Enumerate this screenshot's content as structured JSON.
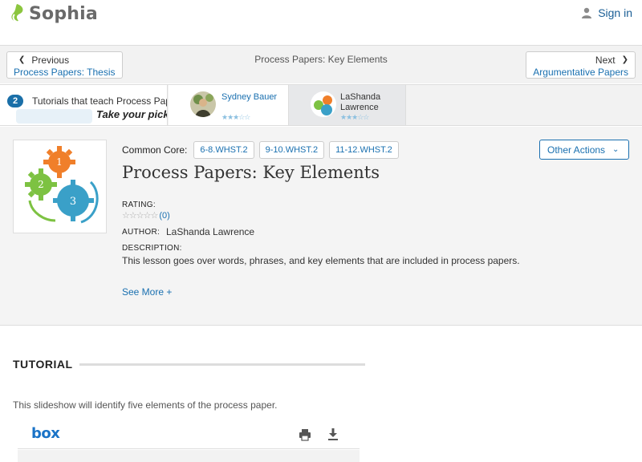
{
  "header": {
    "logo_text": "Sophia",
    "signin_label": "Sign in"
  },
  "nav": {
    "prev_label": "Previous",
    "prev_sub": "Process Papers: Thesis",
    "title": "Process Papers: Key Elements",
    "next_label": "Next",
    "next_sub": "Argumentative Papers"
  },
  "tutorials": {
    "count": "2",
    "text": "Tutorials that teach Process Papers: Key Elements",
    "pick": "Take your pick:",
    "items": [
      {
        "name": "Sydney Bauer",
        "rating_stars": "★★★☆☆",
        "rating": 3
      },
      {
        "name_line1": "LaShanda",
        "name_line2": "Lawrence",
        "rating_stars": "★★★☆☆",
        "rating": 3
      }
    ]
  },
  "detail": {
    "common_core_label": "Common Core:",
    "tags": [
      "6-8.WHST.2",
      "9-10.WHST.2",
      "11-12.WHST.2"
    ],
    "other_actions": "Other Actions",
    "title": "Process Papers: Key Elements",
    "rating_label": "RATING:",
    "rating_stars": "☆☆☆☆☆",
    "rating_count": "(0)",
    "author_label": "AUTHOR:",
    "author": "LaShanda Lawrence",
    "description_label": "DESCRIPTION:",
    "description": "This lesson goes over words, phrases, and key elements that are included in process papers.",
    "see_more": "See More +",
    "thumbnail_gears": [
      "1",
      "2",
      "3"
    ]
  },
  "tutorial": {
    "heading": "TUTORIAL",
    "description": "This slideshow will identify five elements of the process paper.",
    "viewer_logo": "box"
  },
  "colors": {
    "link": "#1a70b0",
    "logo_green": "#8cc63f",
    "gear_orange": "#f07f2a",
    "gear_green": "#7dc242",
    "gear_blue": "#3aa0c8"
  }
}
